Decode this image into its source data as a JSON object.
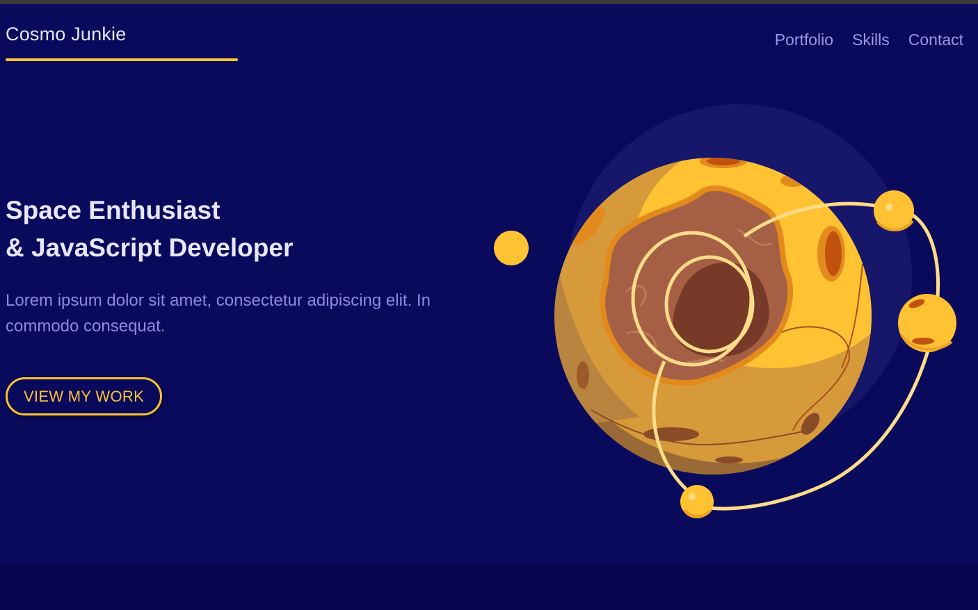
{
  "brand": {
    "name": "Cosmo Junkie"
  },
  "nav": {
    "items": [
      "Portfolio",
      "Skills",
      "Contact"
    ]
  },
  "hero": {
    "title_line1": "Space Enthusiast",
    "title_line2": "& JavaScript Developer",
    "description": "Lorem ipsum dolor sit amet, consectetur adipiscing elit. In commodo consequat.",
    "cta_label": "VIEW MY WORK"
  },
  "colors": {
    "background": "#0a0a5c",
    "accent": "#ffc233",
    "heading_text": "#e8e6ff",
    "muted_text": "#8e88e6"
  },
  "icons": {
    "illustration": "planet-illustration-icon"
  }
}
